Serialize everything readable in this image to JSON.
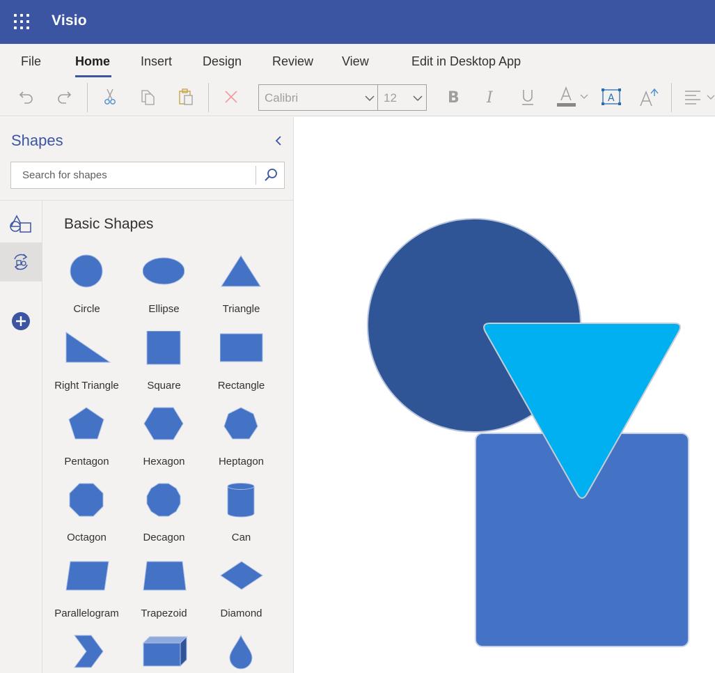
{
  "app": {
    "name": "Visio"
  },
  "ribbon": {
    "tabs": [
      {
        "label": "File"
      },
      {
        "label": "Home"
      },
      {
        "label": "Insert"
      },
      {
        "label": "Design"
      },
      {
        "label": "Review"
      },
      {
        "label": "View"
      },
      {
        "label": "Edit in Desktop App"
      }
    ],
    "active_tab": "Home",
    "font_name": "Calibri",
    "font_size": "12"
  },
  "panel": {
    "title": "Shapes",
    "search_placeholder": "Search for shapes",
    "stencil_title": "Basic Shapes",
    "shapes": [
      {
        "label": "Circle"
      },
      {
        "label": "Ellipse"
      },
      {
        "label": "Triangle"
      },
      {
        "label": "Right Triangle"
      },
      {
        "label": "Square"
      },
      {
        "label": "Rectangle"
      },
      {
        "label": "Pentagon"
      },
      {
        "label": "Hexagon"
      },
      {
        "label": "Heptagon"
      },
      {
        "label": "Octagon"
      },
      {
        "label": "Decagon"
      },
      {
        "label": "Can"
      },
      {
        "label": "Parallelogram"
      },
      {
        "label": "Trapezoid"
      },
      {
        "label": "Diamond"
      },
      {
        "label": ""
      },
      {
        "label": ""
      },
      {
        "label": ""
      }
    ]
  },
  "colors": {
    "brand": "#3b55a3",
    "shape_fill": "#4472c4",
    "canvas_circle": "#2f5597",
    "canvas_triangle": "#00b0f0",
    "canvas_square": "#4472c4"
  }
}
